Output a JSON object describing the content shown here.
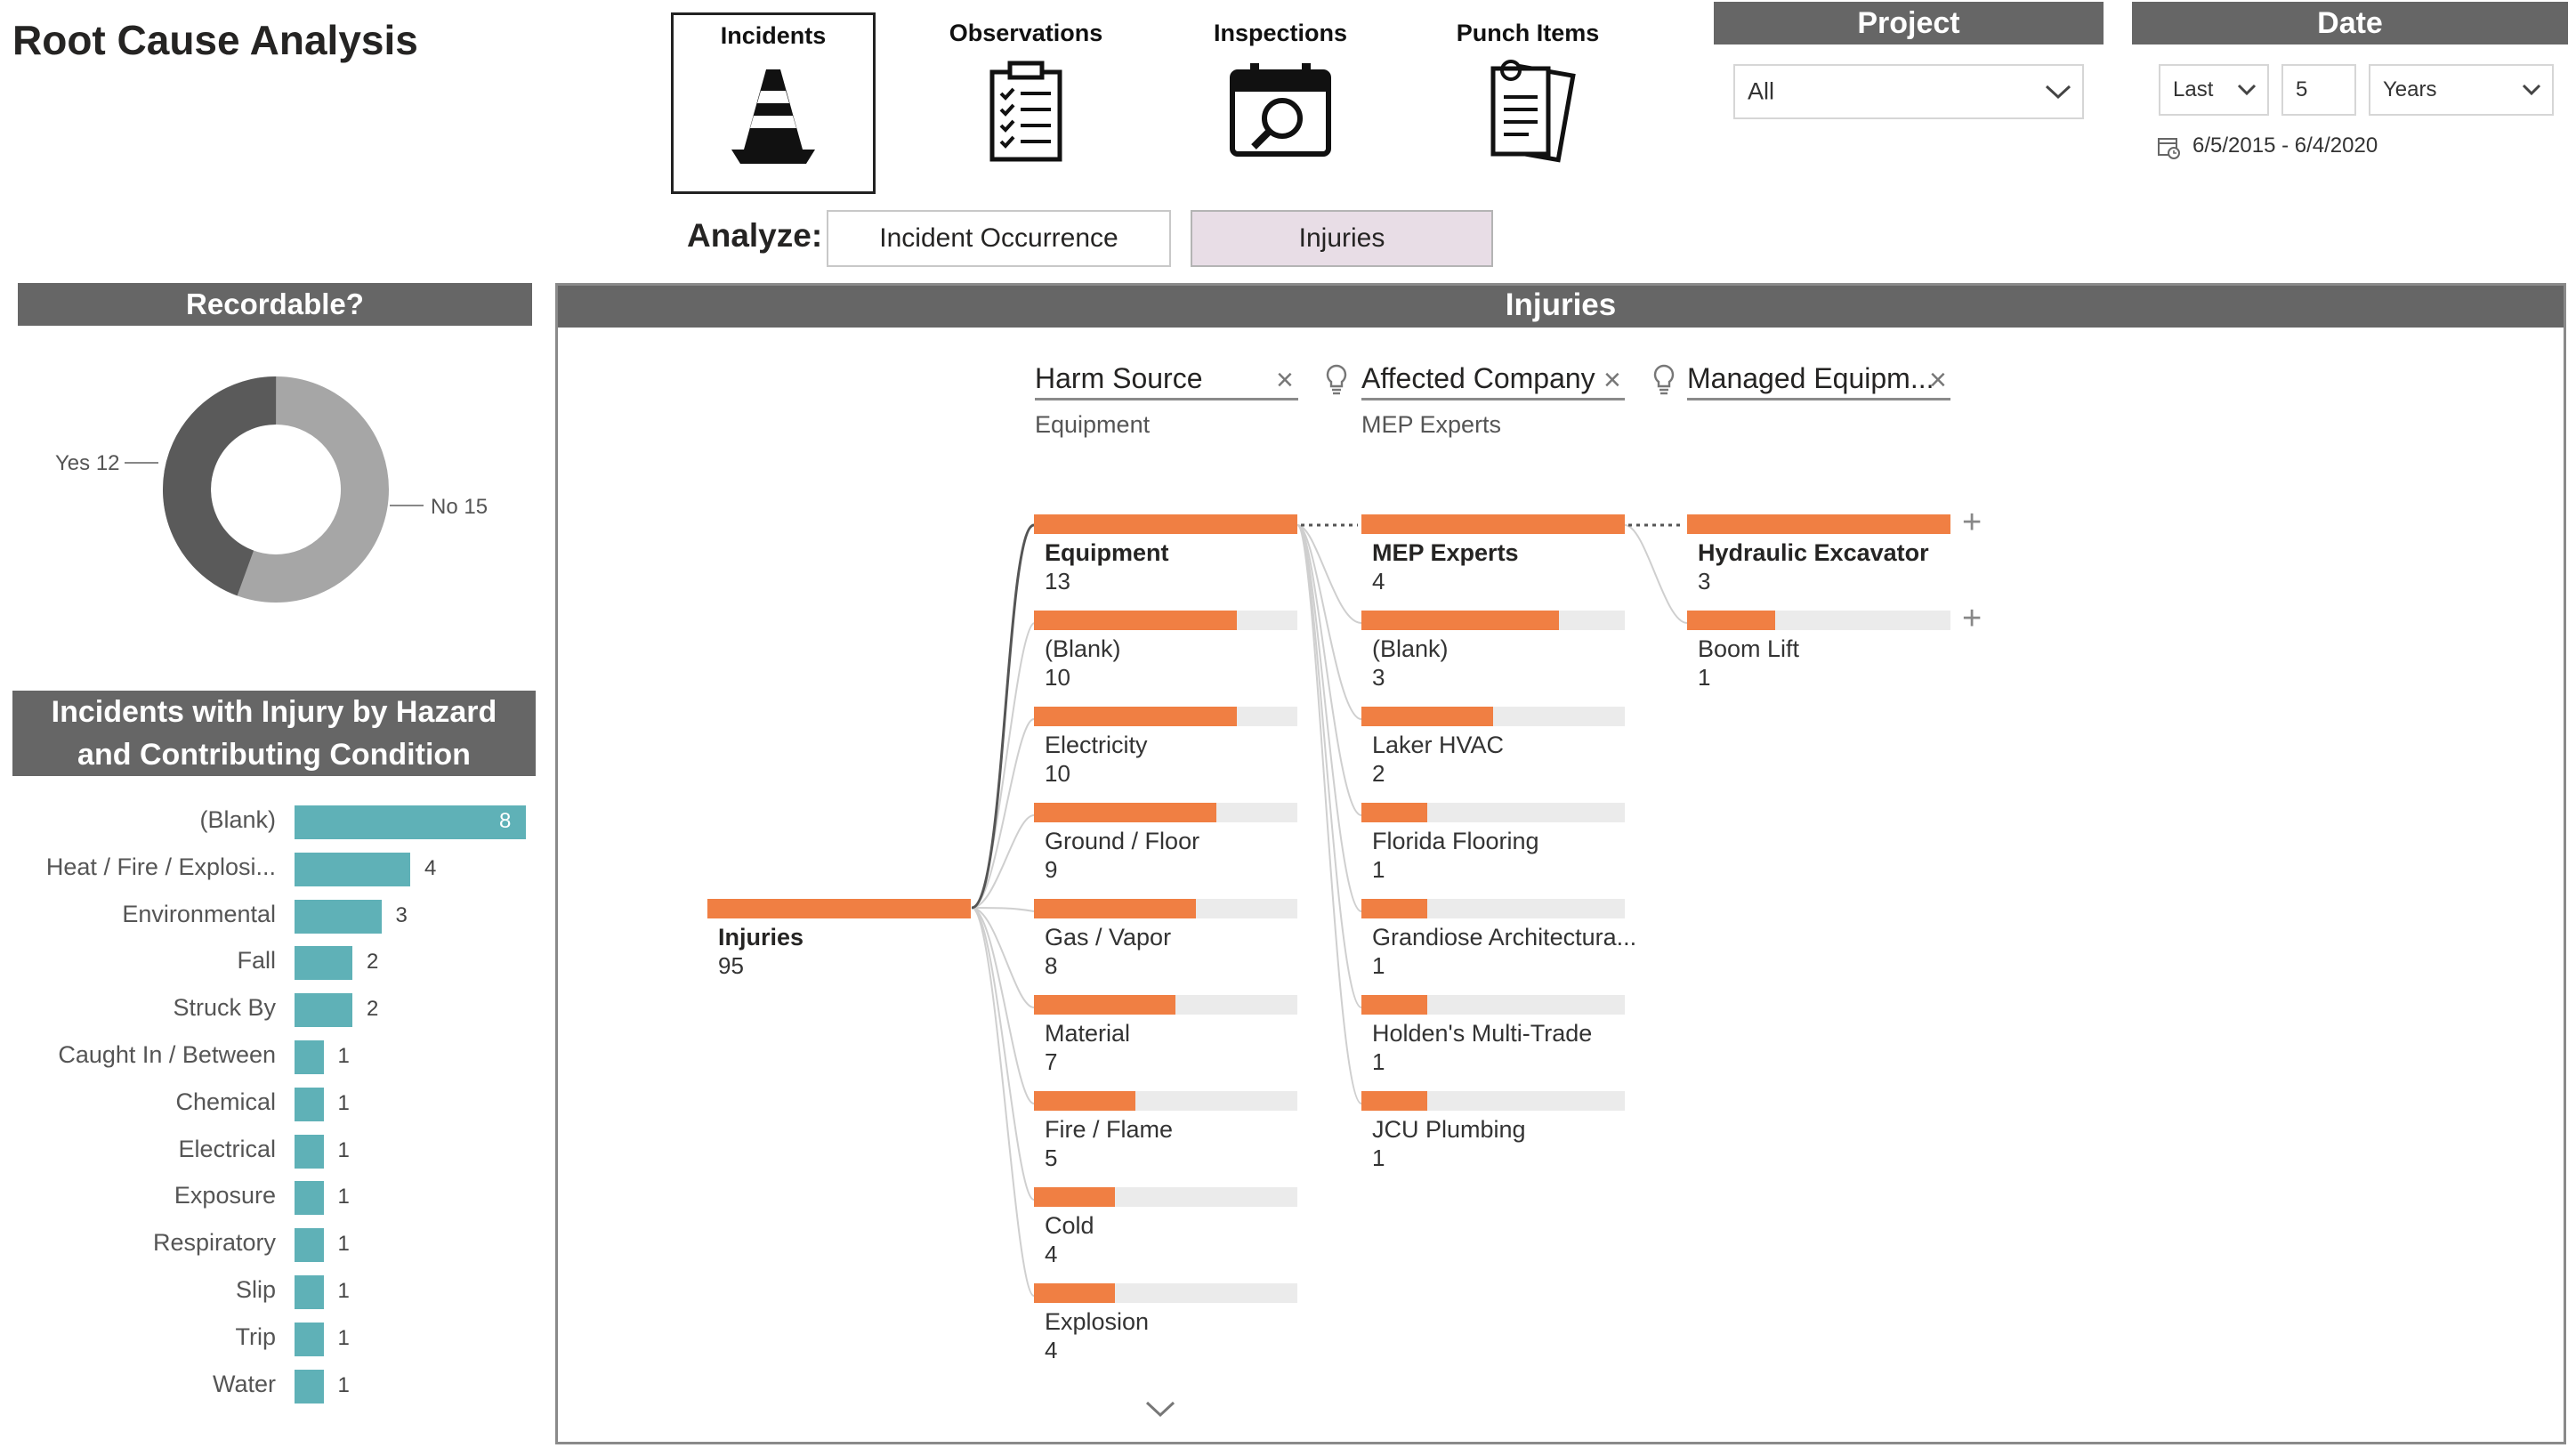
{
  "page": {
    "title": "Root Cause Analysis"
  },
  "categories": [
    {
      "label": "Incidents",
      "icon": "traffic-cone-icon",
      "selected": true
    },
    {
      "label": "Observations",
      "icon": "clipboard-checklist-icon",
      "selected": false
    },
    {
      "label": "Inspections",
      "icon": "calendar-search-icon",
      "selected": false
    },
    {
      "label": "Punch Items",
      "icon": "documents-pin-icon",
      "selected": false
    }
  ],
  "analyze": {
    "label": "Analyze:",
    "options": [
      {
        "label": "Incident Occurrence",
        "active": false
      },
      {
        "label": "Injuries",
        "active": true
      }
    ]
  },
  "project": {
    "header": "Project",
    "value": "All"
  },
  "date": {
    "header": "Date",
    "relative": "Last",
    "count": "5",
    "unit": "Years",
    "range": "6/5/2015 - 6/4/2020"
  },
  "recordable": {
    "header": "Recordable?",
    "yes_label": "Yes 12",
    "no_label": "No 15",
    "yes": 12,
    "no": 15,
    "colors": {
      "yes": "#5a5a5a",
      "no": "#a6a6a6"
    }
  },
  "hazard_chart": {
    "header": "Incidents with Injury by Hazard and Contributing Condition",
    "color": "#5fb1b7",
    "chart_data": {
      "type": "bar",
      "orientation": "horizontal",
      "categories": [
        "(Blank)",
        "Heat / Fire / Explosi...",
        "Environmental",
        "Fall",
        "Struck By",
        "Caught In / Between",
        "Chemical",
        "Electrical",
        "Exposure",
        "Respiratory",
        "Slip",
        "Trip",
        "Water"
      ],
      "values": [
        8,
        4,
        3,
        2,
        2,
        1,
        1,
        1,
        1,
        1,
        1,
        1,
        1
      ],
      "xlim": [
        0,
        8
      ]
    }
  },
  "injuries_panel": {
    "header": "Injuries",
    "root": {
      "name": "Injuries",
      "value": "95"
    },
    "levels": [
      {
        "title": "Harm Source",
        "subtitle": "Equipment"
      },
      {
        "title": "Affected Company",
        "subtitle": "MEP Experts"
      },
      {
        "title": "Managed Equipm...",
        "subtitle": ""
      }
    ],
    "harm_source": [
      {
        "name": "Equipment",
        "value": 13
      },
      {
        "name": "(Blank)",
        "value": 10
      },
      {
        "name": "Electricity",
        "value": 10
      },
      {
        "name": "Ground / Floor",
        "value": 9
      },
      {
        "name": "Gas / Vapor",
        "value": 8
      },
      {
        "name": "Material",
        "value": 7
      },
      {
        "name": "Fire / Flame",
        "value": 5
      },
      {
        "name": "Cold",
        "value": 4
      },
      {
        "name": "Explosion",
        "value": 4
      }
    ],
    "affected_company": [
      {
        "name": "MEP Experts",
        "value": 4
      },
      {
        "name": "(Blank)",
        "value": 3
      },
      {
        "name": "Laker HVAC",
        "value": 2
      },
      {
        "name": "Florida Flooring",
        "value": 1
      },
      {
        "name": "Grandiose Architectura...",
        "value": 1
      },
      {
        "name": "Holden's Multi-Trade",
        "value": 1
      },
      {
        "name": "JCU Plumbing",
        "value": 1
      }
    ],
    "managed_equipment": [
      {
        "name": "Hydraulic Excavator",
        "value": 3
      },
      {
        "name": "Boom Lift",
        "value": 1
      }
    ],
    "bar_color": "#f07f43"
  }
}
